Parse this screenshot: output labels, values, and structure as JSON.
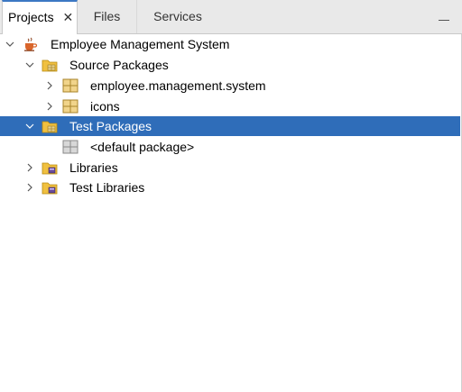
{
  "tabs": [
    {
      "label": "Projects",
      "active": true,
      "closable": true
    },
    {
      "label": "Files",
      "active": false
    },
    {
      "label": "Services",
      "active": false
    }
  ],
  "tree": {
    "project": {
      "label": "Employee Management System",
      "expanded": true,
      "icon": "java-project-icon"
    },
    "source_packages": {
      "label": "Source Packages",
      "expanded": true,
      "icon": "source-packages-folder-icon"
    },
    "pkg_system": {
      "label": "employee.management.system",
      "expanded": false,
      "icon": "package-icon"
    },
    "pkg_icons": {
      "label": "icons",
      "expanded": false,
      "icon": "package-icon"
    },
    "test_packages": {
      "label": "Test Packages",
      "expanded": true,
      "selected": true,
      "icon": "test-packages-folder-icon"
    },
    "default_package": {
      "label": "<default package>",
      "icon": "empty-package-icon"
    },
    "libraries": {
      "label": "Libraries",
      "expanded": false,
      "icon": "libraries-folder-icon"
    },
    "test_libraries": {
      "label": "Test Libraries",
      "expanded": false,
      "icon": "libraries-folder-icon"
    }
  },
  "colors": {
    "selection": "#2f6db9",
    "tab_accent": "#3c78c3"
  }
}
